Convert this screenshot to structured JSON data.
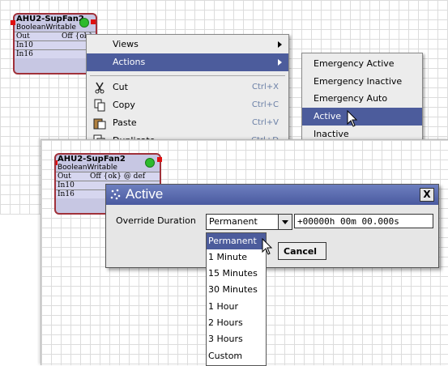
{
  "component": {
    "title": "AHU2-SupFan2",
    "type": "BooleanWritable",
    "rows": [
      {
        "name": "Out",
        "value": "Off {ok}"
      },
      {
        "name": "In10",
        "value": ""
      },
      {
        "name": "In16",
        "value": ""
      }
    ],
    "rows_partial": [
      {
        "name": "Out",
        "value": "Off {ok} @ def"
      },
      {
        "name": "In10",
        "value": ""
      },
      {
        "name": "In16",
        "value": ""
      }
    ]
  },
  "context_menu": {
    "items": [
      {
        "label": "Views",
        "shortcut": "",
        "submenu": true
      },
      {
        "label": "Actions",
        "shortcut": "",
        "submenu": true
      },
      {
        "label": "Cut",
        "shortcut": "Ctrl+X",
        "icon": "scissors-icon"
      },
      {
        "label": "Copy",
        "shortcut": "Ctrl+C",
        "icon": "copy-icon"
      },
      {
        "label": "Paste",
        "shortcut": "Ctrl+V",
        "icon": "paste-icon"
      },
      {
        "label": "Duplicate",
        "shortcut": "Ctrl+D",
        "icon": "duplicate-icon"
      }
    ]
  },
  "actions_submenu": {
    "items": [
      "Emergency Active",
      "Emergency Inactive",
      "Emergency Auto",
      "Active",
      "Inactive"
    ],
    "selected": "Active"
  },
  "dialog": {
    "title": "Active",
    "close_label": "X",
    "override_label": "Override Duration",
    "selected_duration": "Permanent",
    "duration_value": "+00000h 00m 00.000s",
    "cancel_label": "Cancel"
  },
  "duration_options": [
    "Permanent",
    "1 Minute",
    "15 Minutes",
    "30 Minutes",
    "1 Hour",
    "2 Hours",
    "3 Hours",
    "Custom"
  ],
  "colors": {
    "selection": "#4c5c9c",
    "component_border": "#a0313a",
    "component_fill": "#c7c7e3",
    "status_green": "#2dbb2d"
  }
}
